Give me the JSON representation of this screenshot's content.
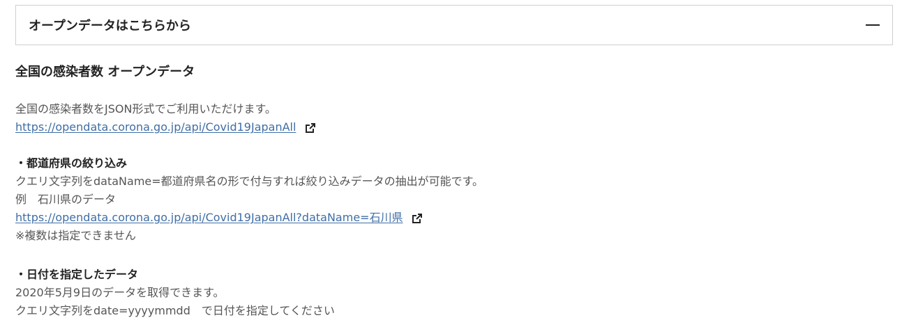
{
  "accordion": {
    "title": "オープンデータはこちらから"
  },
  "section": {
    "heading": "全国の感染者数 オープンデータ",
    "intro": "全国の感染者数をJSON形式でご利用いただけます。",
    "main_link": "https://opendata.corona.go.jp/api/Covid19JapanAll",
    "filter": {
      "heading": "・都道府県の絞り込み",
      "desc": "クエリ文字列をdataName=都道府県名の形で付与すれば絞り込みデータの抽出が可能です。",
      "example": "例　石川県のデータ",
      "link": "https://opendata.corona.go.jp/api/Covid19JapanAll?dataName=石川県",
      "note": "※複数は指定できません"
    },
    "date": {
      "heading": "・日付を指定したデータ",
      "desc": "2020年5月9日のデータを取得できます。",
      "query": "クエリ文字列をdate=yyyymmdd　で日付を指定してください"
    }
  }
}
